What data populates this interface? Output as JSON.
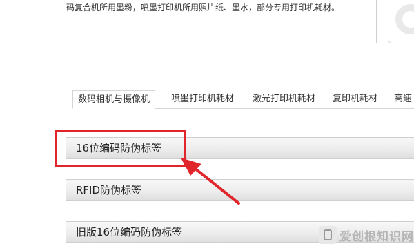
{
  "intro_text": "码复合机所用墨粉，喷墨打印机所用照片纸、墨水，部分专用打印机耗材。",
  "tabs": [
    {
      "label": "数码相机与摄像机",
      "active": true
    },
    {
      "label": "喷墨打印机耗材",
      "active": false
    },
    {
      "label": "激光打印机耗材",
      "active": false
    },
    {
      "label": "复印机耗材",
      "active": false
    },
    {
      "label": "高速",
      "active": false
    }
  ],
  "sections": [
    {
      "label": "16位编码防伪标签"
    },
    {
      "label": "RFID防伪标签"
    },
    {
      "label": "旧版16位编码防伪标签"
    }
  ],
  "annotation": {
    "color": "#e0262b",
    "target": "16位编码防伪标签"
  },
  "watermark": {
    "text": "爱创根知识网"
  }
}
